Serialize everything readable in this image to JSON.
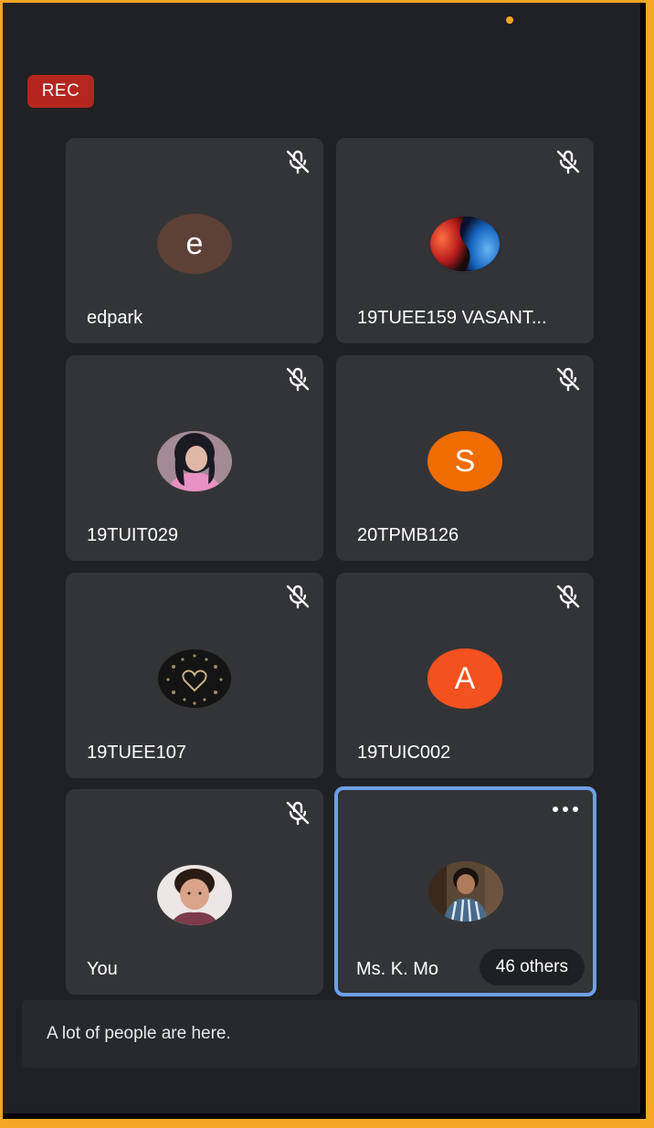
{
  "header": {
    "rec_label": "REC"
  },
  "participants": [
    {
      "name": "edpark",
      "avatar_type": "initial",
      "initial": "e",
      "avatar_color": "#5d4037",
      "muted": true
    },
    {
      "name": "19TUEE159 VASANT...",
      "avatar_type": "photo",
      "photo": "fire-ice-sphere",
      "muted": true
    },
    {
      "name": "19TUIT029",
      "avatar_type": "photo",
      "photo": "person-portrait",
      "muted": true
    },
    {
      "name": "20TPMB126",
      "avatar_type": "initial",
      "initial": "S",
      "avatar_color": "#ef6c00",
      "muted": true
    },
    {
      "name": "19TUEE107",
      "avatar_type": "photo",
      "photo": "dark-heart-pattern",
      "muted": true
    },
    {
      "name": "19TUIC002",
      "avatar_type": "initial",
      "initial": "A",
      "avatar_color": "#f4511e",
      "muted": true
    },
    {
      "name": "You",
      "avatar_type": "photo",
      "photo": "person-portrait",
      "muted": true
    },
    {
      "name": "Ms. K. Mo",
      "avatar_type": "photo",
      "photo": "person-portrait",
      "muted": false,
      "active": true,
      "others_label": "46 others"
    }
  ],
  "notice": {
    "text": "A lot of people are here."
  },
  "colors": {
    "background": "#202124",
    "tile": "#333437",
    "active_border": "#6ea0e8",
    "rec": "#b3261e",
    "frame": "#f5a623"
  },
  "icons": {
    "muted": "mic-off-icon",
    "more": "more-options-icon"
  }
}
